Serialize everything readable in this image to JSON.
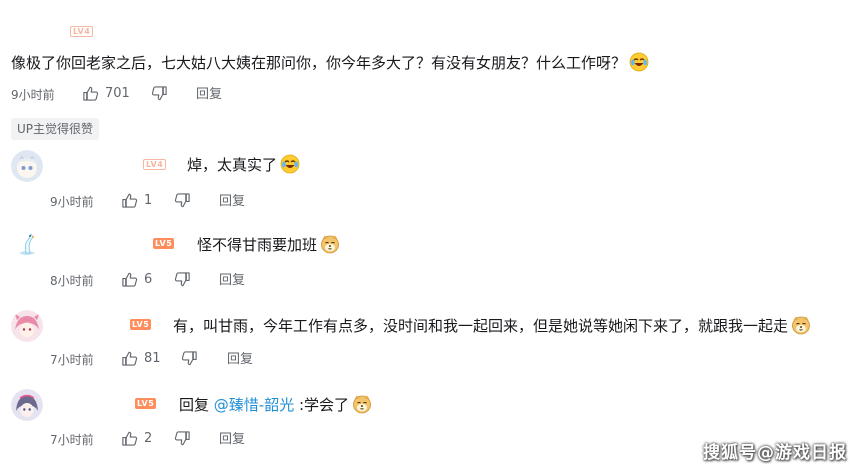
{
  "main_comment": {
    "level": "LV4",
    "text": "像极了你回老家之后，七大姑八大姨在那问你，你今年多大了？有没有女朋友？什么工作呀？",
    "emoji": "laugh-cry-emoji",
    "time": "9小时前",
    "likes": "701",
    "reply_label": "回复",
    "up_tag": "UP主觉得很赞"
  },
  "replies": [
    {
      "level": "LV4",
      "text": "焯，太真实了",
      "emoji": "laugh-cry-emoji",
      "time": "9小时前",
      "likes": "1",
      "reply_label": "回复"
    },
    {
      "level": "LV5",
      "text": "怪不得甘雨要加班",
      "emoji": "doge-emoji",
      "time": "8小时前",
      "likes": "6",
      "reply_label": "回复"
    },
    {
      "level": "LV5",
      "text": "有，叫甘雨，今年工作有点多，没时间和我一起回来，但是她说等她闲下来了，就跟我一起走",
      "emoji": "doge-emoji",
      "time": "7小时前",
      "likes": "81",
      "reply_label": "回复"
    },
    {
      "level": "LV5",
      "prefix": "回复",
      "mention": "@臻惜-韶光",
      "suffix": ":学会了",
      "emoji": "doge-emoji",
      "time": "7小时前",
      "likes": "2",
      "reply_label": "回复"
    }
  ],
  "watermark": "搜狐号@游戏日报",
  "colors": {
    "level4": "#f6b7a0",
    "level5": "#ff8e5c",
    "mention": "#1f8fd6",
    "meta": "#61666d"
  }
}
